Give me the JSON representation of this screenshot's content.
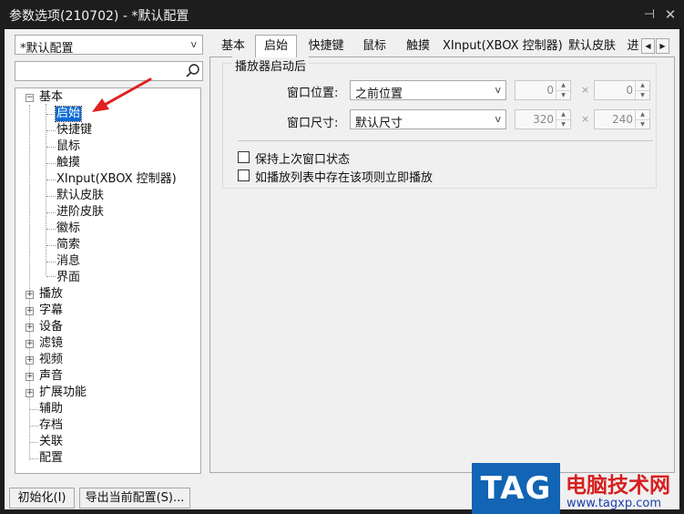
{
  "window": {
    "title": "参数选项(210702) - *默认配置",
    "pin_glyph": "⊣",
    "close_glyph": "✕"
  },
  "profile_select": {
    "value": "*默认配置"
  },
  "search": {
    "value": "",
    "placeholder": ""
  },
  "tree": {
    "root": "基本",
    "children": [
      "启始",
      "快捷键",
      "鼠标",
      "触摸",
      "XInput(XBOX 控制器)",
      "默认皮肤",
      "进阶皮肤",
      "徽标",
      "简索",
      "消息",
      "界面"
    ],
    "selected": "启始",
    "collapsed": [
      "播放",
      "字幕",
      "设备",
      "滤镜",
      "视频",
      "声音",
      "扩展功能"
    ],
    "leaves": [
      "辅助",
      "存档",
      "关联",
      "配置"
    ]
  },
  "buttons": {
    "init": "初始化(I)",
    "export": "导出当前配置(S)..."
  },
  "tabs": [
    "基本",
    "启始",
    "快捷键",
    "鼠标",
    "触摸",
    "XInput(XBOX 控制器)",
    "默认皮肤",
    "进"
  ],
  "active_tab": "启始",
  "group": {
    "title": "播放器启动后",
    "position_label": "窗口位置:",
    "position_value": "之前位置",
    "size_label": "窗口尺寸:",
    "size_value": "默认尺寸",
    "pos_x": "0",
    "pos_y": "0",
    "size_w": "320",
    "size_h": "240",
    "times": "×",
    "keep_state_label": "保持上次窗口状态",
    "keep_state_checked": false,
    "play_if_in_list_label": "如播放列表中存在该项则立即播放",
    "play_if_in_list_checked": false
  },
  "watermark": {
    "tag": "TAG",
    "site": "电脑技术网",
    "url": "www.tagxp.com"
  },
  "colors": {
    "selection": "#0a6ad6",
    "annotation_arrow": "#e02020",
    "watermark_blue": "#1264b4",
    "watermark_red": "#d71f1f"
  }
}
